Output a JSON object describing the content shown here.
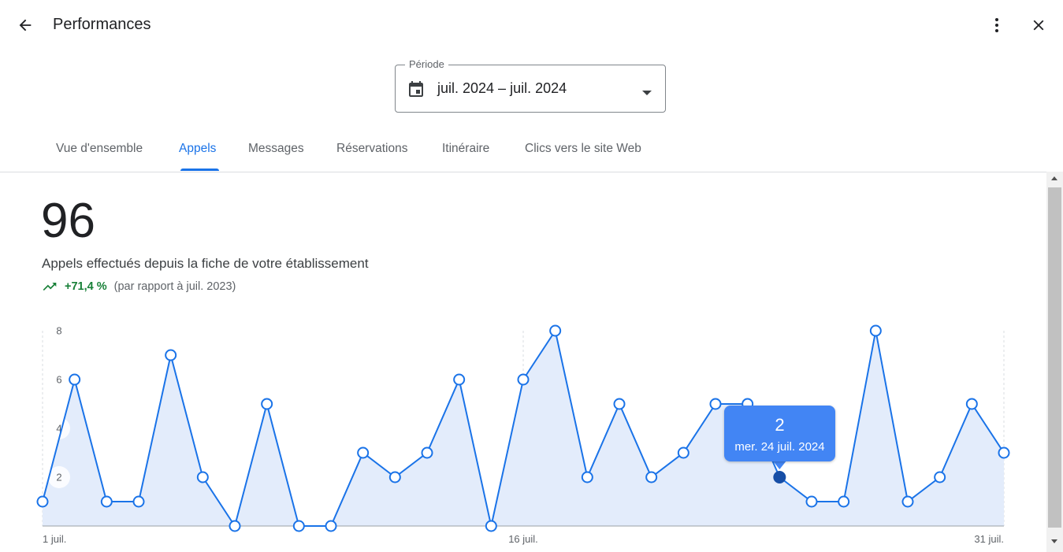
{
  "header": {
    "title": "Performances",
    "back_icon": "arrow-back-icon",
    "more_icon": "more-vert-icon",
    "close_icon": "close-icon"
  },
  "period": {
    "label": "Période",
    "value": "juil. 2024 – juil. 2024",
    "icon": "calendar-icon"
  },
  "tabs": [
    {
      "label": "Vue d'ensemble",
      "active": false
    },
    {
      "label": "Appels",
      "active": true
    },
    {
      "label": "Messages",
      "active": false
    },
    {
      "label": "Réservations",
      "active": false
    },
    {
      "label": "Itinéraire",
      "active": false
    },
    {
      "label": "Clics vers le site Web",
      "active": false
    }
  ],
  "summary": {
    "total": "96",
    "description": "Appels effectués depuis la fiche de votre établissement",
    "trend_value": "+71,4 %",
    "trend_compare": "(par rapport à juil. 2023)"
  },
  "colors": {
    "accent": "#1a73e8",
    "line": "#1a73e8",
    "area": "#e3ecfb",
    "trend_up": "#188038",
    "tooltip": "#4285f4"
  },
  "chart_data": {
    "type": "area",
    "x": [
      "1",
      "2",
      "3",
      "4",
      "5",
      "6",
      "7",
      "8",
      "9",
      "10",
      "11",
      "12",
      "13",
      "14",
      "15",
      "16",
      "17",
      "18",
      "19",
      "20",
      "21",
      "22",
      "23",
      "24",
      "25",
      "26",
      "27",
      "28",
      "29",
      "30",
      "31"
    ],
    "series": [
      {
        "values": [
          1,
          6,
          1,
          1,
          7,
          2,
          0,
          5,
          0,
          0,
          3,
          2,
          3,
          6,
          0,
          6,
          8,
          2,
          5,
          2,
          3,
          5,
          5,
          2,
          1,
          1,
          8,
          1,
          2,
          5,
          3
        ]
      }
    ],
    "y_ticks": [
      "2",
      "4",
      "6",
      "8"
    ],
    "x_tick_labels": [
      "1 juil.",
      "16 juil.",
      "31 juil."
    ],
    "ylim": [
      0,
      8
    ],
    "highlighted_index": 23,
    "tooltip": {
      "value": "2",
      "date": "mer. 24 juil. 2024"
    }
  }
}
